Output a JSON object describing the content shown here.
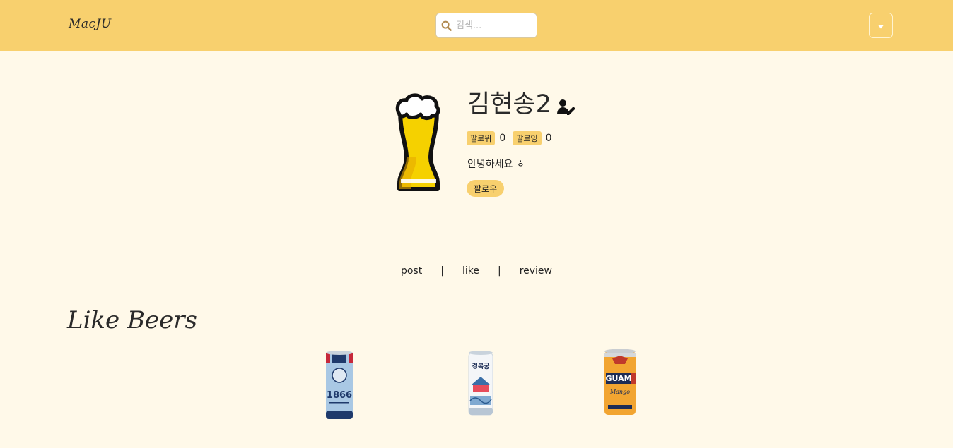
{
  "navbar": {
    "brand": "MacJU",
    "search": {
      "placeholder": "검색...",
      "value": ""
    },
    "icons": {
      "search": "search-icon",
      "menu": "caret-down-icon"
    }
  },
  "profile": {
    "username": "김현송2",
    "edit_icon": "user-edit-icon",
    "followers_label": "팔로워",
    "followers_count": "0",
    "following_label": "팔로잉",
    "following_count": "0",
    "bio": "안녕하세요 ㅎ",
    "follow_button": "팔로우"
  },
  "tabs": [
    {
      "label": "post"
    },
    {
      "label": "like"
    },
    {
      "label": "review"
    }
  ],
  "tab_separator": "|",
  "liked_section": {
    "title": "Like Beers",
    "beers": [
      {
        "image": "beer-can-1866",
        "can_text": "1866"
      },
      {
        "image": "beer-can-gyeongbokgung",
        "can_text": "경복궁"
      },
      {
        "image": "beer-can-guam",
        "can_text": "GUAM"
      }
    ]
  },
  "colors": {
    "navbar": "#f8d06e",
    "background": "#fff9e9",
    "accent": "#f8d06e"
  }
}
